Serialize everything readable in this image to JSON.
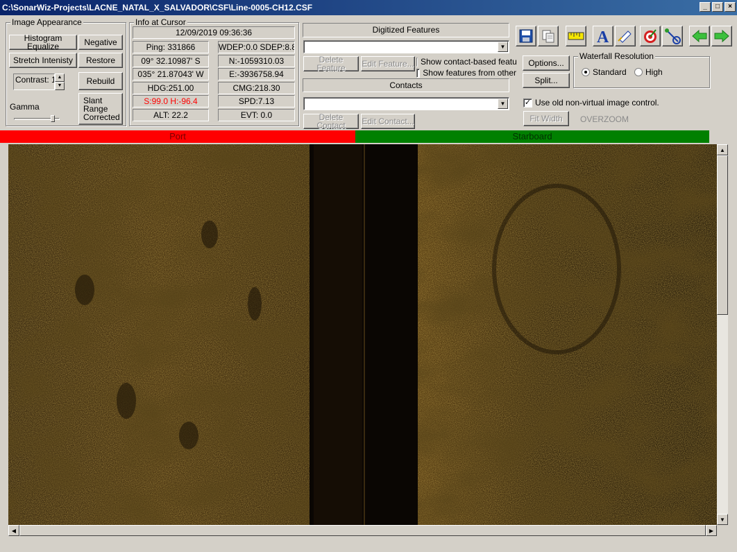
{
  "window": {
    "title": "C:\\SonarWiz-Projects\\LACNE_NATAL_X_SALVADOR\\CSF\\Line-0005-CH12.CSF",
    "minimize": "_",
    "maximize": "□",
    "close": "×"
  },
  "image_appearance": {
    "legend": "Image Appearance",
    "histogram_equalize": "Histogram Equalize",
    "negative": "Negative",
    "stretch_intensity": "Stretch Intenisty",
    "restore": "Restore",
    "contrast_value": "Contrast: 1",
    "rebuild": "Rebuild",
    "gamma_label": "Gamma",
    "gamma_level": 0.85,
    "slant_range": "Slant\nRange\nCorrected"
  },
  "info_cursor": {
    "legend": "Info at Cursor",
    "datetime": "12/09/2019 09:36:36",
    "ping": "Ping: 331866",
    "wdep": "WDEP:0.0 SDEP:8.8",
    "lat": "09° 32.10987' S",
    "northing": "N:-1059310.03",
    "lon": "035° 21.87043' W",
    "easting": "E:-3936758.94",
    "hdg": "HDG:251.00",
    "cmg": "CMG:218.30",
    "sh": "S:99.0 H:-96.4",
    "spd": "SPD:7.13",
    "alt": "ALT: 22.2",
    "evt": "EVT: 0.0"
  },
  "digitized": {
    "header": "Digitized Features",
    "selected": "",
    "delete_feature": "Delete Feature",
    "edit_feature": "Edit Feature...",
    "show_contact_based": "Show contact-based featu",
    "show_from_other": "Show features from other",
    "contacts_header": "Contacts",
    "contacts_selected": "",
    "delete_contact": "Delete Contact",
    "edit_contact": "Edit Contact..."
  },
  "toolbar": {
    "icons": [
      "save-icon",
      "copy-icon",
      "ruler-icon",
      "text-icon",
      "annotate-icon",
      "target-icon",
      "measure-icon",
      "back-arrow-icon",
      "forward-arrow-icon"
    ]
  },
  "options": {
    "options_button": "Options...",
    "split_button": "Split...",
    "waterfall_legend": "Waterfall Resolution",
    "standard": "Standard",
    "high": "High",
    "use_old_control": "Use old non-virtual image control.",
    "fit_width": "Fit Width",
    "overzoom": "OVERZOOM"
  },
  "channels": {
    "port": "Port",
    "starboard": "Starboard",
    "port_color": "#ff0000",
    "starboard_color": "#008000"
  },
  "scroll": {
    "up": "▲",
    "down": "▼",
    "left": "◀",
    "right": "▶"
  }
}
